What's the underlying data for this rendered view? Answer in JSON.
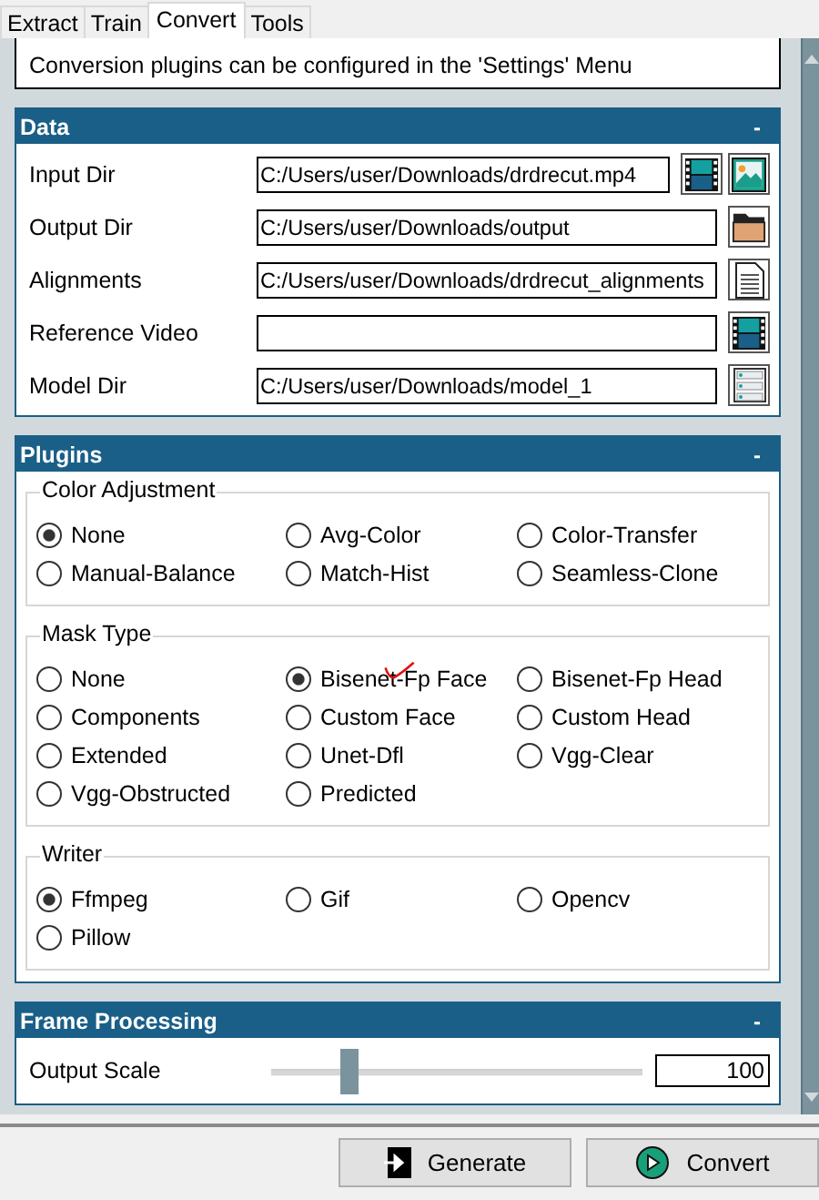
{
  "tabs": [
    {
      "label": "Extract",
      "selected": false
    },
    {
      "label": "Train",
      "selected": false
    },
    {
      "label": "Convert",
      "selected": true
    },
    {
      "label": "Tools",
      "selected": false
    }
  ],
  "info": {
    "text": "Conversion plugins can be configured in the 'Settings' Menu"
  },
  "data": {
    "title": "Data",
    "toggle": "-",
    "rows": [
      {
        "label": "Input Dir",
        "value": "C:/Users/user/Downloads/drdrecut.mp4",
        "buttons": [
          {
            "kind": "film"
          },
          {
            "kind": "image"
          }
        ]
      },
      {
        "label": "Output Dir",
        "value": "C:/Users/user/Downloads/output",
        "buttons": [
          {
            "kind": "folder"
          }
        ]
      },
      {
        "label": "Alignments",
        "value": "C:/Users/user/Downloads/drdrecut_alignments",
        "buttons": [
          {
            "kind": "document"
          }
        ]
      },
      {
        "label": "Reference Video",
        "buttons": [
          {
            "kind": "film"
          }
        ]
      },
      {
        "label": "Model Dir",
        "value": "C:/Users/user/Downloads/model_1",
        "buttons": [
          {
            "kind": "list"
          }
        ]
      }
    ]
  },
  "plugins": {
    "title": "Plugins",
    "toggle": "-",
    "groups": [
      {
        "title": "Color Adjustment",
        "options": [
          {
            "label": "None",
            "selected": true
          },
          {
            "label": "Avg-Color",
            "selected": false
          },
          {
            "label": "Color-Transfer",
            "selected": false
          },
          {
            "label": "Manual-Balance",
            "selected": false
          },
          {
            "label": "Match-Hist",
            "selected": false
          },
          {
            "label": "Seamless-Clone",
            "selected": false
          }
        ]
      },
      {
        "title": "Mask Type",
        "options": [
          {
            "label": "None",
            "selected": false
          },
          {
            "label": "Bisenet-Fp Face",
            "selected": true
          },
          {
            "label": "Bisenet-Fp Head",
            "selected": false
          },
          {
            "label": "Components",
            "selected": false
          },
          {
            "label": "Custom Face",
            "selected": false
          },
          {
            "label": "Custom Head",
            "selected": false
          },
          {
            "label": "Extended",
            "selected": false
          },
          {
            "label": "Unet-Dfl",
            "selected": false
          },
          {
            "label": "Vgg-Clear",
            "selected": false
          },
          {
            "label": "Vgg-Obstructed",
            "selected": false
          },
          {
            "label": "Predicted",
            "selected": false
          }
        ]
      },
      {
        "title": "Writer",
        "options": [
          {
            "label": "Ffmpeg",
            "selected": true
          },
          {
            "label": "Gif",
            "selected": false
          },
          {
            "label": "Opencv",
            "selected": false
          },
          {
            "label": "Pillow",
            "selected": false
          }
        ]
      }
    ]
  },
  "frame_processing": {
    "title": "Frame Processing",
    "toggle": "-",
    "sliders": [
      {
        "label": "Output Scale",
        "level": 0.21,
        "value": "100"
      }
    ]
  },
  "buttons": [
    {
      "label": "Generate",
      "kind": "generate"
    },
    {
      "label": "Convert",
      "kind": "convert"
    }
  ]
}
